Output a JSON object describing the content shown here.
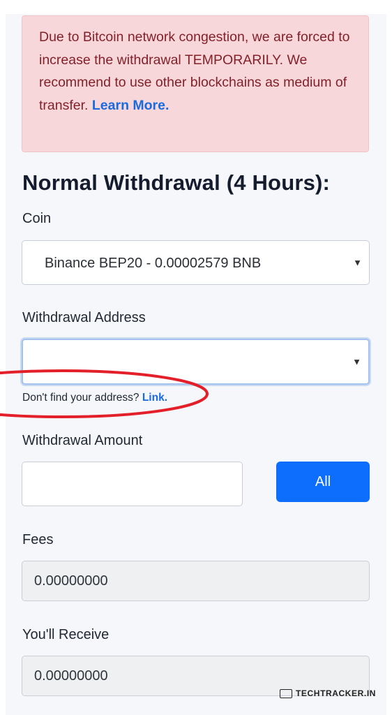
{
  "alert": {
    "message": "Due to Bitcoin network congestion, we are forced to increase the withdrawal TEMPORARILY. We recommend to use other blockchains as medium of transfer. ",
    "link_text": "Learn More."
  },
  "heading": "Normal Withdrawal (4 Hours):",
  "coin": {
    "label": "Coin",
    "selected": "Binance BEP20 - 0.00002579 BNB"
  },
  "address": {
    "label": "Withdrawal Address",
    "value": "",
    "help_text": "Don't find your address? ",
    "help_link": "Link."
  },
  "amount": {
    "label": "Withdrawal Amount",
    "value": "",
    "all_button": "All"
  },
  "fees": {
    "label": "Fees",
    "value": "0.00000000"
  },
  "receive": {
    "label": "You'll Receive",
    "value": "0.00000000"
  },
  "watermark": "TECHTRACKER.IN",
  "colors": {
    "alert_bg": "#f8d7da",
    "alert_text": "#842029",
    "link": "#1a6be0",
    "primary_button": "#0d6efd",
    "annotation_oval": "#e3202a"
  }
}
